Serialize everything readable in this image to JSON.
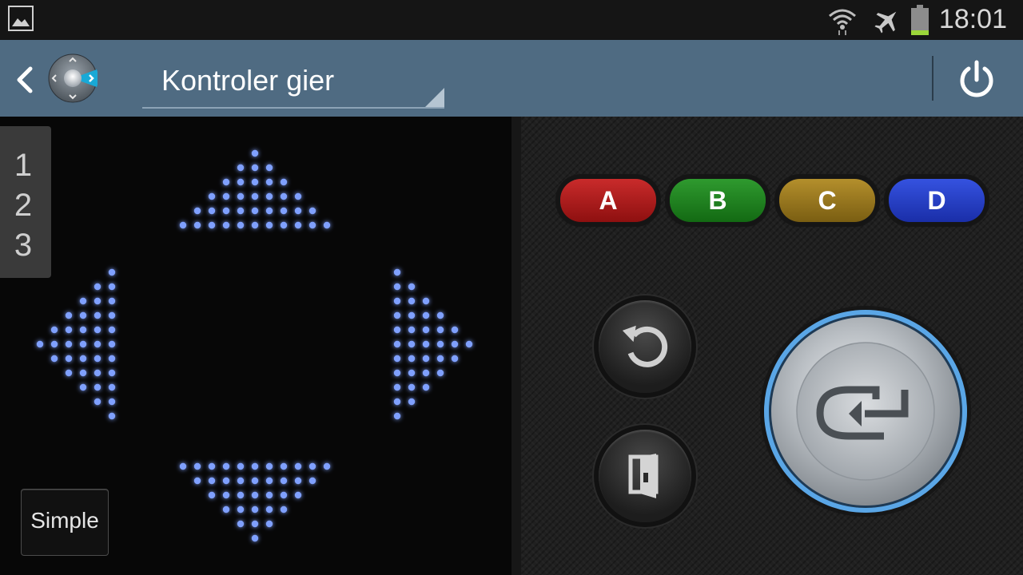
{
  "status_bar": {
    "time": "18:01",
    "icons": [
      "gallery-icon",
      "wifi-icon",
      "airplane-icon",
      "battery-icon"
    ]
  },
  "action_bar": {
    "title": "Kontroler gier",
    "back_icon": "chevron-left-icon",
    "app_icon": "remote-dpad-icon",
    "power_icon": "power-icon"
  },
  "page_tabs": [
    "1",
    "2",
    "3"
  ],
  "left_pane": {
    "dpad": [
      "up",
      "left",
      "right",
      "down"
    ],
    "mode_button": "Simple"
  },
  "right_pane": {
    "color_buttons": [
      {
        "label": "A",
        "color": "#b81d1d"
      },
      {
        "label": "B",
        "color": "#1f7f1f"
      },
      {
        "label": "C",
        "color": "#9a7620"
      },
      {
        "label": "D",
        "color": "#2540c8"
      }
    ],
    "return_icon": "return-icon",
    "exit_icon": "exit-door-icon",
    "ok_icon": "enter-icon",
    "accent": "#5aa6e6"
  }
}
